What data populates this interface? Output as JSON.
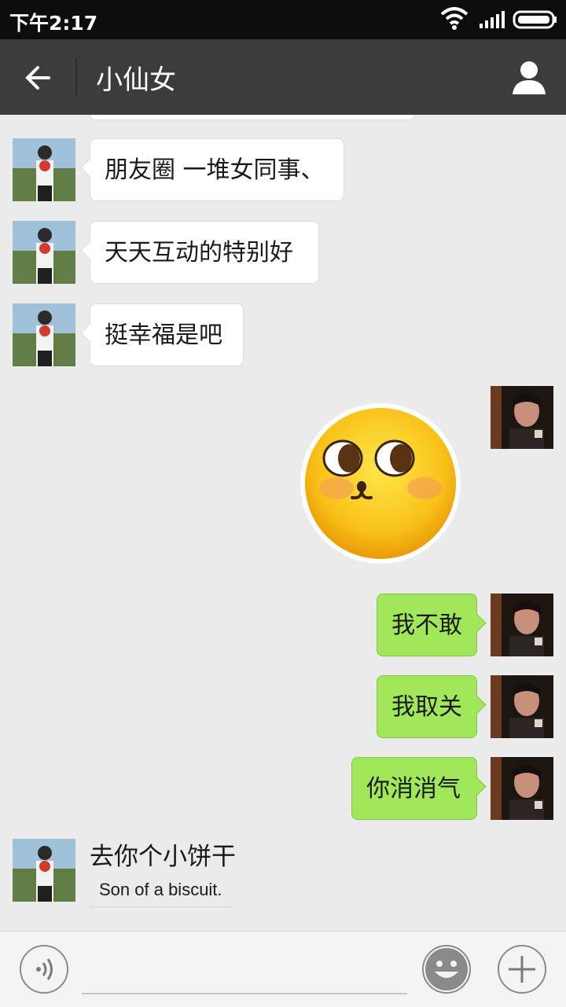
{
  "status_bar": {
    "time": "下午2:17"
  },
  "header": {
    "title": "小仙女"
  },
  "messages": [
    {
      "side": "left",
      "text": "朋友圈 一堆女同事、"
    },
    {
      "side": "left",
      "text": "天天互动的特别好"
    },
    {
      "side": "left",
      "text": "挺幸福是吧"
    },
    {
      "side": "right",
      "type": "sticker",
      "sticker": "blushing-face-emoji"
    },
    {
      "side": "right",
      "text": "我不敢"
    },
    {
      "side": "right",
      "text": "我取关"
    },
    {
      "side": "right",
      "text": "你消消气"
    },
    {
      "side": "left",
      "text": "去你个小饼干",
      "translation": "Son of a biscuit."
    }
  ],
  "colors": {
    "sent_bubble": "#a0e75a",
    "received_bubble": "#ffffff",
    "header": "#3a3d40"
  }
}
